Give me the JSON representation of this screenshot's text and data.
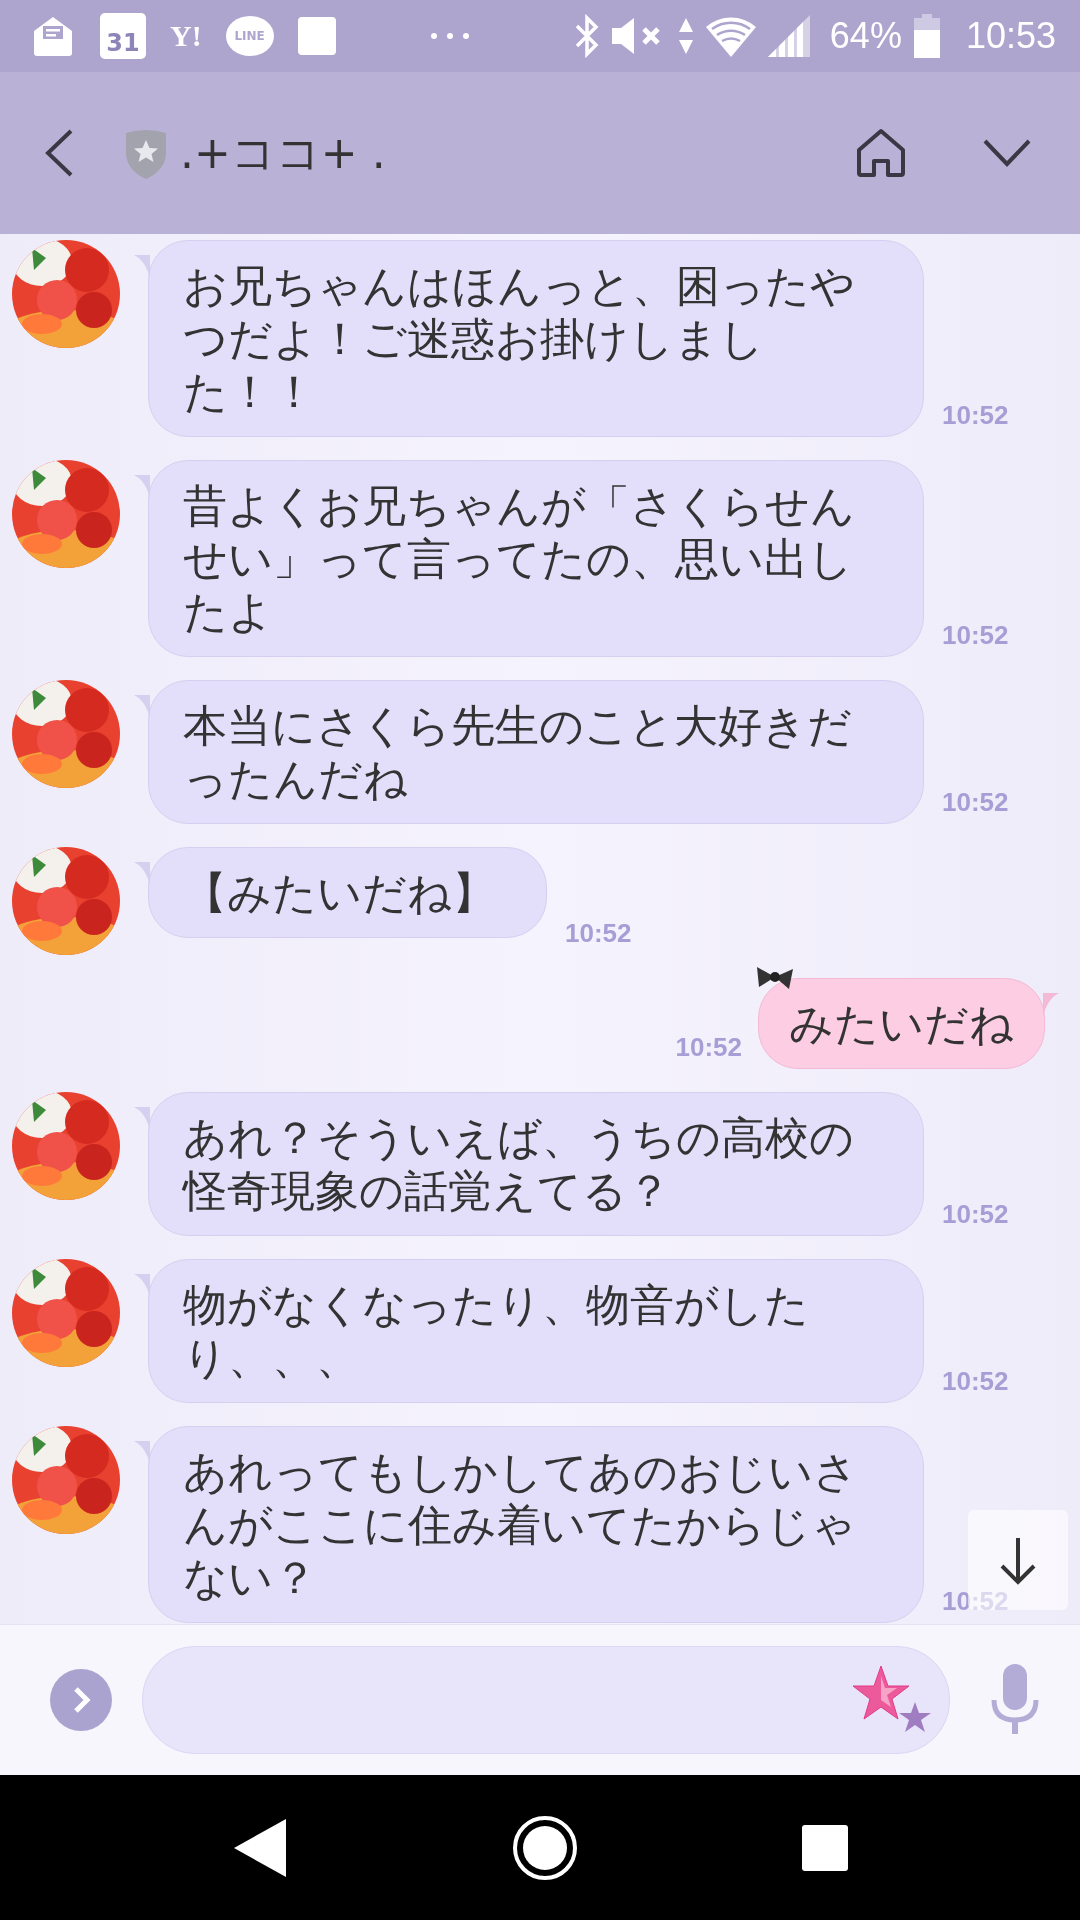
{
  "status_bar": {
    "calendar_day": "31",
    "yahoo": "Y!",
    "line": "LINE",
    "battery": "64%",
    "time": "10:53"
  },
  "header": {
    "title": ".+ココ+ ."
  },
  "messages": [
    {
      "kind": "received",
      "text": "お兄ちゃんはほんっと、困ったやつだよ！ご迷惑お掛けしました！！",
      "time": "10:52"
    },
    {
      "kind": "received",
      "text": "昔よくお兄ちゃんが「さくらせんせい」って言ってたの、思い出したよ",
      "time": "10:52"
    },
    {
      "kind": "received",
      "text": "本当にさくら先生のこと大好きだったんだね",
      "time": "10:52"
    },
    {
      "kind": "received",
      "text": "【みたいだね】",
      "time": "10:52"
    },
    {
      "kind": "sent",
      "text": "みたいだね",
      "time": "10:52"
    },
    {
      "kind": "received",
      "text": "あれ？そういえば、うちの高校の怪奇現象の話覚えてる？",
      "time": "10:52"
    },
    {
      "kind": "received",
      "text": "物がなくなったり、物音がしたり、、、",
      "time": "10:52"
    },
    {
      "kind": "received",
      "text": "あれってもしかしてあのおじいさんがここに住み着いてたからじゃない？",
      "time": "10:52"
    }
  ]
}
